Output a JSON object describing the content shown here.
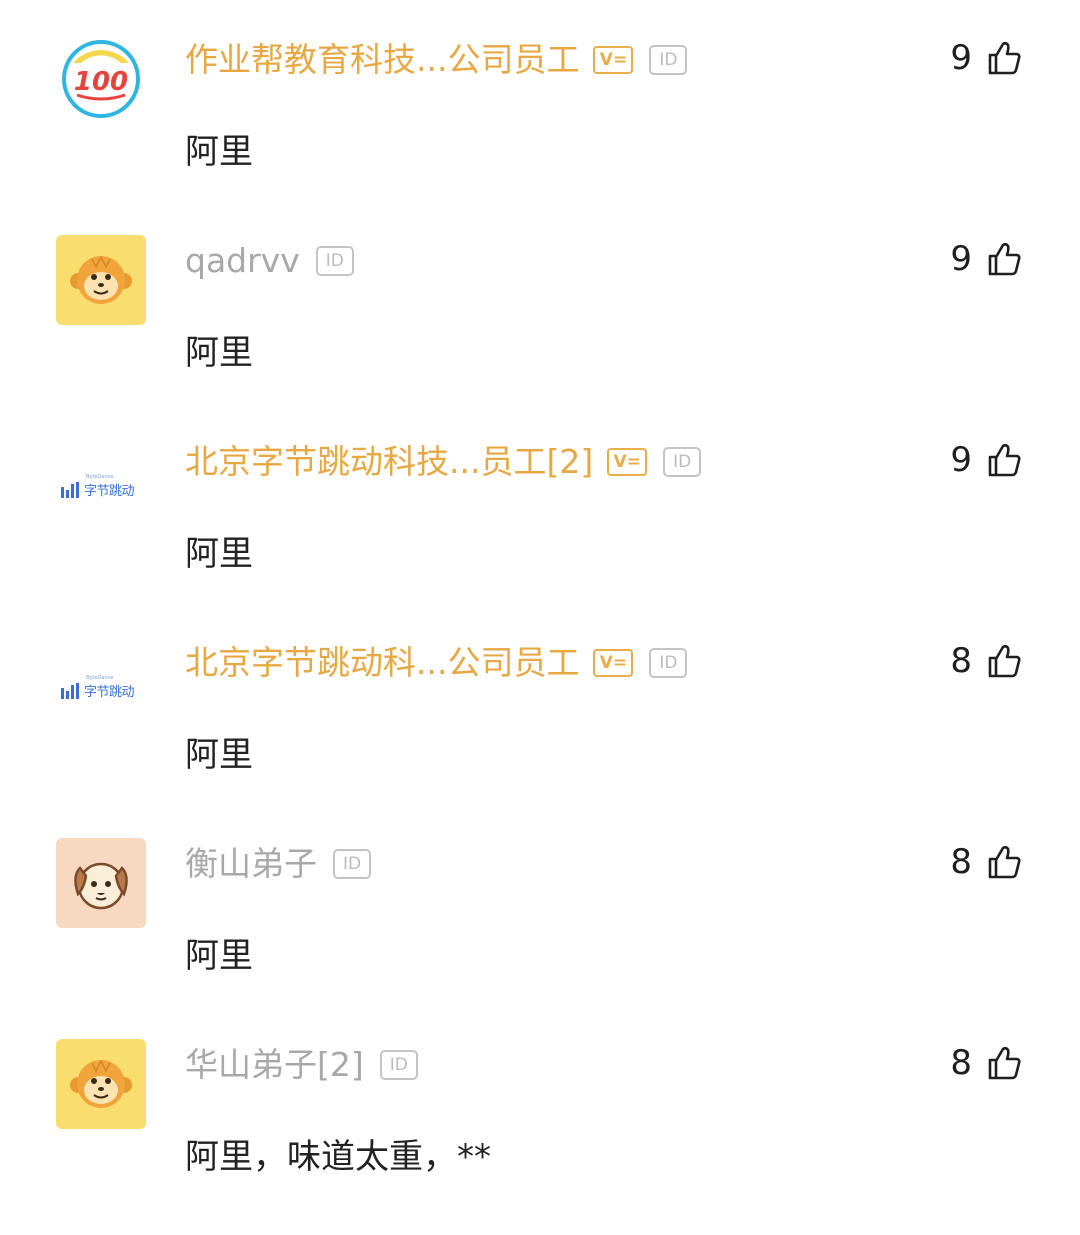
{
  "comments": [
    {
      "author": "作业帮教育科技...公司员工",
      "verified_badge": "V=",
      "id_badge": "ID",
      "text": "阿里",
      "likes": "9",
      "avatar": "zuoyebang-100-logo"
    },
    {
      "author": "qadrvv",
      "id_badge": "ID",
      "text": "阿里",
      "likes": "9",
      "avatar": "monkey-avatar"
    },
    {
      "author": "北京字节跳动科技...员工[2]",
      "verified_badge": "V=",
      "id_badge": "ID",
      "text": "阿里",
      "likes": "9",
      "avatar": "bytedance-logo",
      "avatar_label": "字节跳动",
      "avatar_sublabel": "ByteDance"
    },
    {
      "author": "北京字节跳动科...公司员工",
      "verified_badge": "V=",
      "id_badge": "ID",
      "text": "阿里",
      "likes": "8",
      "avatar": "bytedance-logo",
      "avatar_label": "字节跳动",
      "avatar_sublabel": "ByteDance"
    },
    {
      "author": "衡山弟子",
      "id_badge": "ID",
      "text": "阿里",
      "likes": "8",
      "avatar": "dog-avatar"
    },
    {
      "author": "华山弟子[2]",
      "id_badge": "ID",
      "text": "阿里，味道太重，**",
      "likes": "8",
      "avatar": "monkey-avatar"
    }
  ],
  "avatar_logo_text": "100",
  "colors": {
    "company_name": "#e7a844",
    "plain_name": "#a8a8a8",
    "body": "#222222",
    "brand_blue": "#3a6fd8"
  }
}
